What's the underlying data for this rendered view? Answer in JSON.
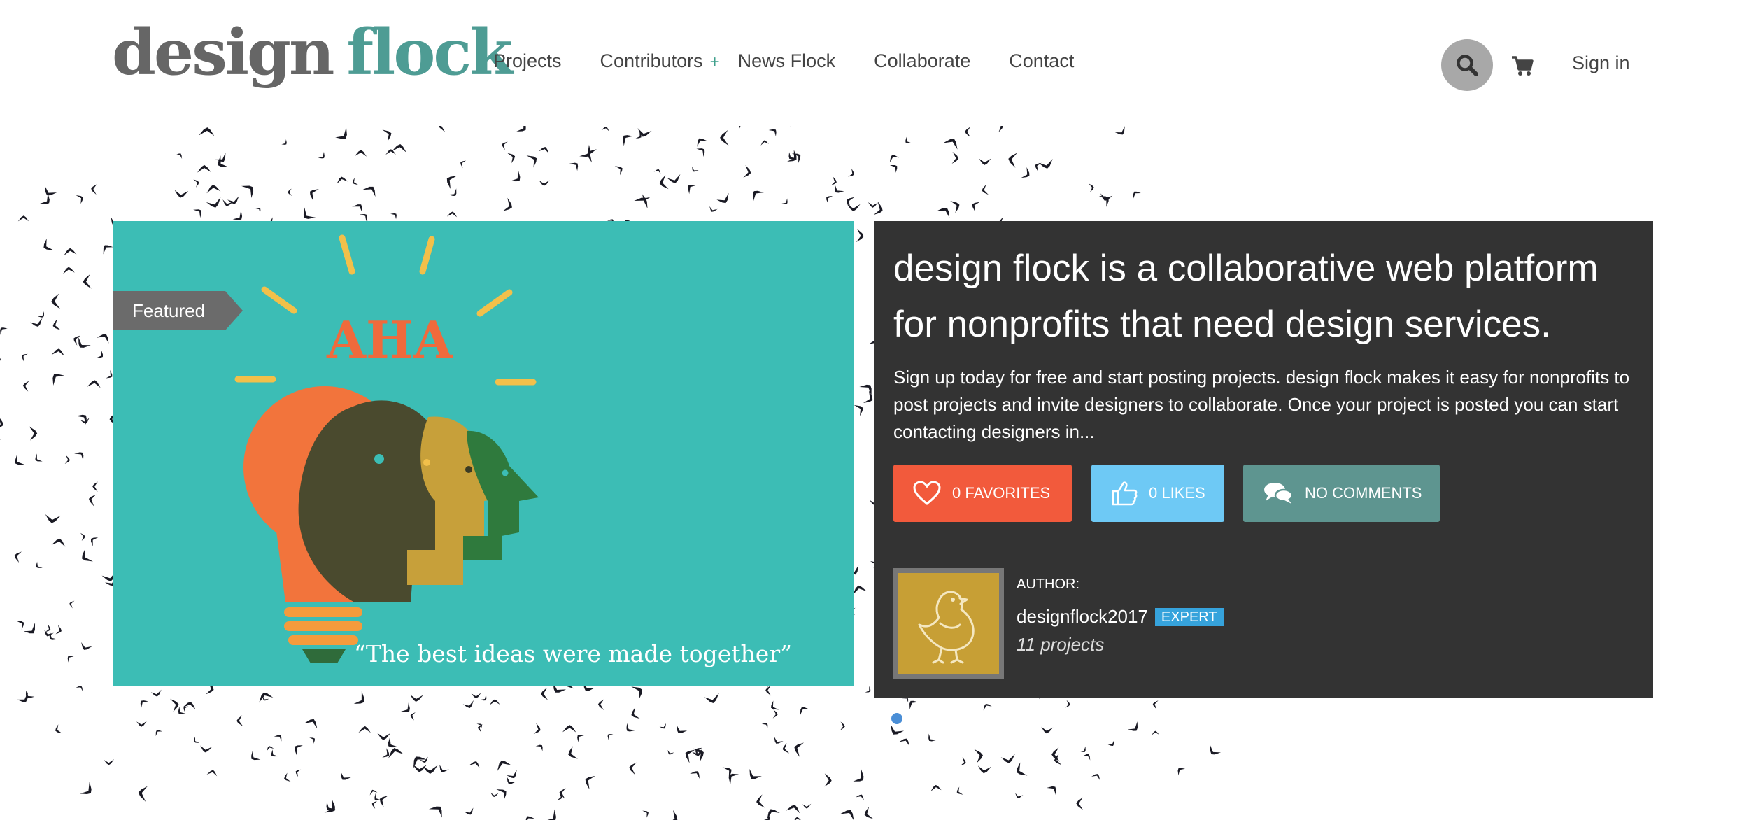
{
  "header": {
    "logo": {
      "word1": "design",
      "word2": "flock"
    },
    "nav": [
      {
        "label": "Projects"
      },
      {
        "label": "Contributors",
        "suffix": "+"
      },
      {
        "label": "News Flock"
      },
      {
        "label": "Collaborate"
      },
      {
        "label": "Contact"
      }
    ],
    "search_icon": "search-icon",
    "cart_icon": "cart-icon",
    "signin_label": "Sign in"
  },
  "featured": {
    "tag": "Featured",
    "image": {
      "headline": "AHA",
      "quote": "“The best ideas were made together”",
      "background": "#3cbdb5"
    }
  },
  "panel": {
    "title": "design flock is a collaborative web platform for nonprofits that need design services.",
    "description": "Sign up today for free and start posting projects. design flock makes it easy for nonprofits to post projects and invite designers to collaborate. Once your project is posted you can start contacting designers in...",
    "buttons": {
      "favorites": {
        "label": "0 FAVORITES",
        "icon": "heart-icon",
        "color": "#f25a3c"
      },
      "likes": {
        "label": "0 LIKES",
        "icon": "thumbs-up-icon",
        "color": "#6ec9f5"
      },
      "comments": {
        "label": "NO COMMENTS",
        "icon": "comments-icon",
        "color": "#5e9590"
      }
    },
    "author": {
      "label": "AUTHOR:",
      "name": "designflock2017",
      "badge": "EXPERT",
      "projects": "11 projects",
      "avatar_icon": "bird-icon"
    }
  },
  "colors": {
    "brand_teal": "#4e9c94",
    "panel_bg": "#333333",
    "badge_blue": "#36a3dc"
  }
}
